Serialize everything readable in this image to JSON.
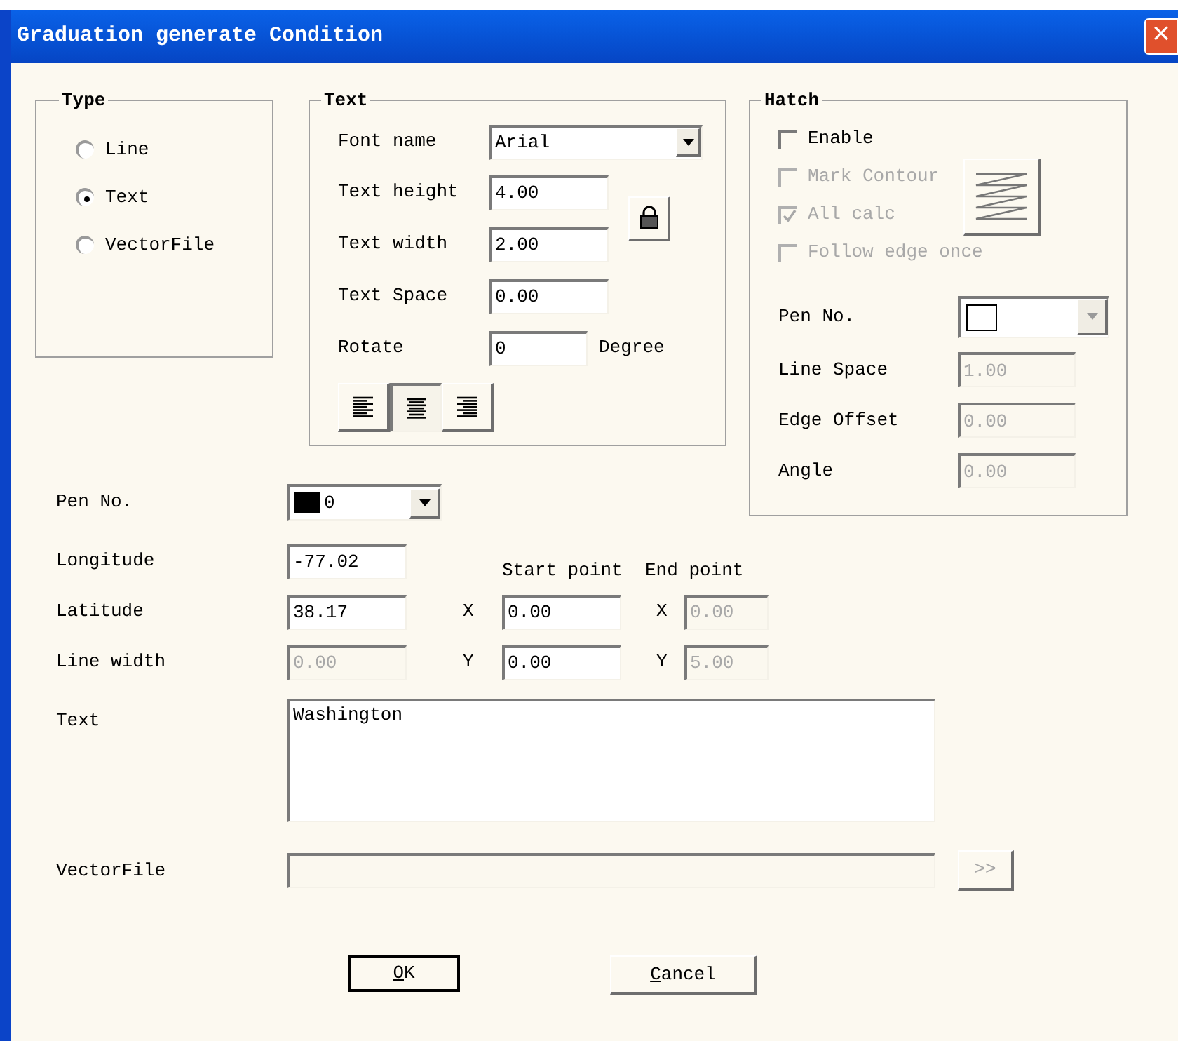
{
  "window": {
    "title": "Graduation generate Condition",
    "close": "×"
  },
  "type_group": {
    "title": "Type",
    "options": [
      {
        "label": "Line",
        "selected": false
      },
      {
        "label": "Text",
        "selected": true
      },
      {
        "label": "VectorFile",
        "selected": false
      }
    ]
  },
  "text_group": {
    "title": "Text",
    "font_name": {
      "label": "Font name",
      "value": "Arial"
    },
    "size_fields": [
      {
        "label": "Text height",
        "value": "4.00"
      },
      {
        "label": "Text width",
        "value": "2.00"
      }
    ],
    "space": {
      "label": "Text Space",
      "value": "0.00"
    },
    "rotate": {
      "label": "Rotate",
      "value": "0",
      "unit": "Degree"
    },
    "alignment": [
      {
        "kind": "left",
        "selected": false
      },
      {
        "kind": "center",
        "selected": true
      },
      {
        "kind": "right",
        "selected": false
      }
    ]
  },
  "hatch": {
    "title": "Hatch",
    "options": [
      {
        "label": "Enable",
        "checked": false,
        "disabled": false
      },
      {
        "label": "Mark Contour",
        "checked": false,
        "disabled": true
      },
      {
        "label": "All calc",
        "checked": true,
        "disabled": true
      },
      {
        "label": "Follow edge once",
        "checked": false,
        "disabled": true
      }
    ],
    "pen": {
      "label": "Pen No.",
      "color": "#ffffff",
      "disabled": true
    },
    "fields": [
      {
        "label": "Line Space",
        "value": "1.00",
        "disabled": true
      },
      {
        "label": "Edge Offset",
        "value": "0.00",
        "disabled": true
      },
      {
        "label": "Angle",
        "value": "0.00",
        "disabled": true
      }
    ]
  },
  "pen": {
    "label": "Pen No.",
    "value": "0",
    "color": "#000000"
  },
  "fields": [
    {
      "label": "Longitude",
      "value": "-77.02",
      "disabled": false
    },
    {
      "label": "Latitude",
      "value": "38.17",
      "disabled": false
    },
    {
      "label": "Line width",
      "value": "0.00",
      "disabled": true
    }
  ],
  "points": {
    "start_label": "Start point",
    "end_label": "End point",
    "rows": [
      {
        "start_axis": "X",
        "start": "0.00",
        "end_axis": "X",
        "end": "0.00",
        "end_disabled": true
      },
      {
        "start_axis": "Y",
        "start": "0.00",
        "end_axis": "Y",
        "end": "5.00",
        "end_disabled": true
      }
    ]
  },
  "text": {
    "label": "Text",
    "value": "Washington"
  },
  "vector_file": {
    "label": "VectorFile",
    "browse": ">>",
    "disabled": true
  },
  "buttons": [
    {
      "label": "OK",
      "default": true
    },
    {
      "label": "Cancel",
      "default": false
    }
  ]
}
